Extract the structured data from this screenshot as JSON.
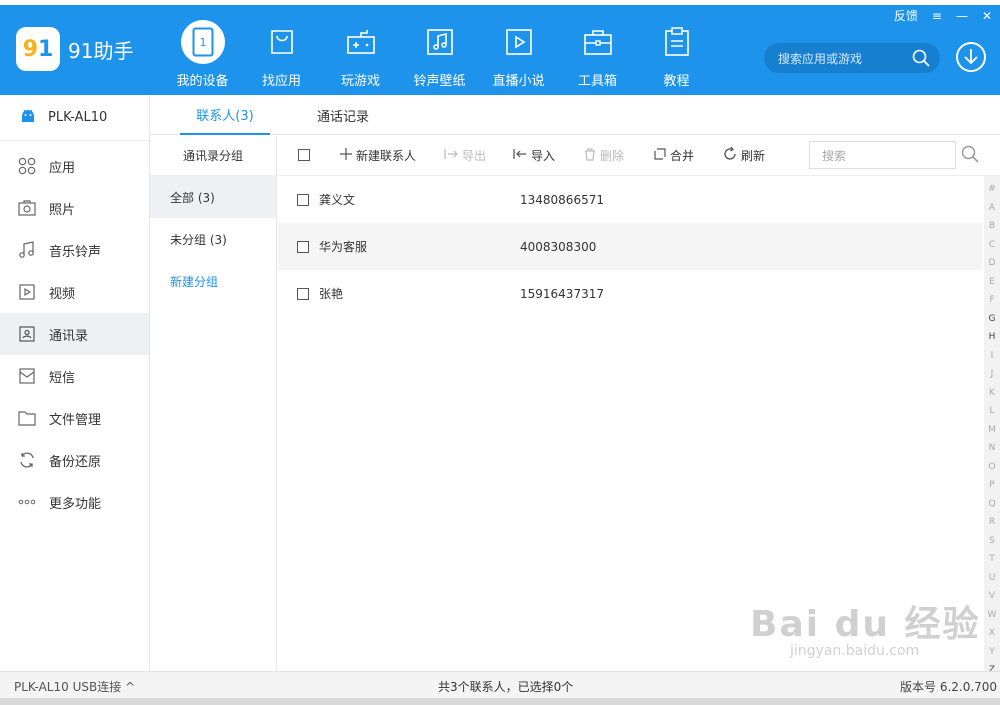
{
  "app": {
    "name": "91助手",
    "logo_text": "9"
  },
  "window": {
    "feedback": "反馈",
    "dropdown": "≡",
    "minimize": "—",
    "close": "✕"
  },
  "nav": [
    {
      "label": "我的设备",
      "icon": "phone-icon",
      "active": true
    },
    {
      "label": "找应用",
      "icon": "bag-icon"
    },
    {
      "label": "玩游戏",
      "icon": "gamepad-icon"
    },
    {
      "label": "铃声壁纸",
      "icon": "music-image-icon"
    },
    {
      "label": "直播小说",
      "icon": "play-icon"
    },
    {
      "label": "工具箱",
      "icon": "toolbox-icon"
    },
    {
      "label": "教程",
      "icon": "clipboard-icon"
    }
  ],
  "search": {
    "placeholder": "搜索应用或游戏"
  },
  "device": {
    "name": "PLK-AL10"
  },
  "sidebar": {
    "items": [
      {
        "label": "应用",
        "icon": "apps-icon"
      },
      {
        "label": "照片",
        "icon": "camera-icon"
      },
      {
        "label": "音乐铃声",
        "icon": "music-icon"
      },
      {
        "label": "视频",
        "icon": "video-icon"
      },
      {
        "label": "通讯录",
        "icon": "contacts-icon",
        "active": true
      },
      {
        "label": "短信",
        "icon": "mail-icon"
      },
      {
        "label": "文件管理",
        "icon": "folder-icon"
      },
      {
        "label": "备份还原",
        "icon": "sync-icon"
      },
      {
        "label": "更多功能",
        "icon": "more-icon"
      }
    ]
  },
  "tabs": [
    {
      "label": "联系人(3)",
      "active": true
    },
    {
      "label": "通话记录"
    }
  ],
  "groups": {
    "title": "通讯录分组",
    "items": [
      {
        "label": "全部 (3)",
        "active": true
      },
      {
        "label": "未分组 (3)"
      },
      {
        "label": "新建分组",
        "link": true
      }
    ]
  },
  "toolbar": {
    "new_contact": "新建联系人",
    "export": "导出",
    "import": "导入",
    "delete": "删除",
    "merge": "合并",
    "refresh": "刷新",
    "search_placeholder": "搜索"
  },
  "contacts": [
    {
      "name": "龚义文",
      "phone": "13480866571"
    },
    {
      "name": "华为客服",
      "phone": "4008308300"
    },
    {
      "name": "张艳",
      "phone": "15916437317"
    }
  ],
  "alphabet": [
    "#",
    "A",
    "B",
    "C",
    "D",
    "E",
    "F",
    "G",
    "H",
    "I",
    "J",
    "K",
    "L",
    "M",
    "N",
    "O",
    "P",
    "Q",
    "R",
    "S",
    "T",
    "U",
    "V",
    "W",
    "X",
    "Y",
    "Z"
  ],
  "alphabet_strong": [
    "G",
    "H",
    "Z"
  ],
  "status": {
    "connection": "PLK-AL10  USB连接 ^",
    "summary": "共3个联系人，已选择0个",
    "version": "版本号 6.2.0.700"
  },
  "watermark": {
    "main": "Bai du 经验",
    "sub": "jingyan.baidu.com"
  },
  "colors": {
    "accent": "#1e93ec",
    "logo_yellow": "#f7b21b"
  }
}
